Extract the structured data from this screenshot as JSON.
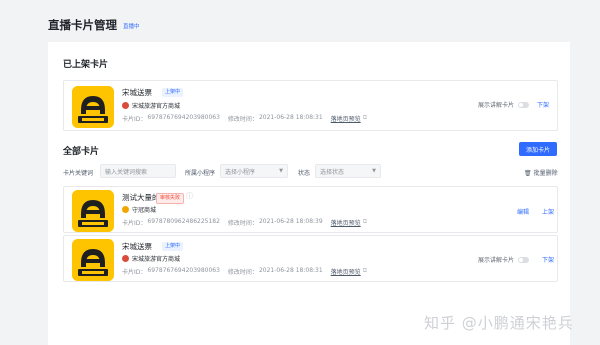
{
  "page": {
    "title": "直播卡片管理",
    "badge": "直播中"
  },
  "listed_section": {
    "title": "已上架卡片",
    "card": {
      "product_title": "宋城送票",
      "status_tag": "上架中",
      "shop_name": "宋城旅游官方商城",
      "card_id_label": "卡片ID：",
      "card_id": "697876769420398006​3",
      "modified_label": "修改时间：",
      "modified_time": "2021-06-28 18:08:31",
      "link_text": "落地页预览",
      "toggle_label": "展示讲解卡片",
      "action": "下架"
    }
  },
  "all_section": {
    "title": "全部卡片",
    "add_button": "添加卡片",
    "filters": {
      "keyword_label": "卡片关键词",
      "keyword_placeholder": "输入关键词搜索",
      "program_label": "所属小程序",
      "program_value": "选择小程序",
      "status_label": "状态",
      "status_value": "选择状态"
    },
    "batch_delete": "批量删除",
    "cards": [
      {
        "product_title": "测试大量的",
        "status_tag": "审核失败",
        "shop_name": "守冠商城",
        "card_id_label": "卡片ID：",
        "card_id": "6978780962486225182",
        "modified_label": "修改时间：",
        "modified_time": "2021-06-28 18:08:39",
        "link_text": "落地页预览",
        "actions": [
          "编辑",
          "上架"
        ]
      },
      {
        "product_title": "宋城送票",
        "status_tag": "上架中",
        "shop_name": "宋城旅游官方商城",
        "card_id_label": "卡片ID：",
        "card_id": "6978767694203980063",
        "modified_label": "修改时间：",
        "modified_time": "2021-06-28 18:08:31",
        "link_text": "落地页预览",
        "toggle_label": "展示讲解卡片",
        "action": "下架"
      }
    ]
  },
  "watermark": "知乎 @小鹏通宋艳兵",
  "colors": {
    "accent": "#2f6bff",
    "thumb_yellow": "#ffc400",
    "error_red": "#f24b3d"
  },
  "icons": [
    "car-logo-icon",
    "info-icon",
    "toggle-icon",
    "trash-icon",
    "chevron-down-icon",
    "warning-icon"
  ]
}
